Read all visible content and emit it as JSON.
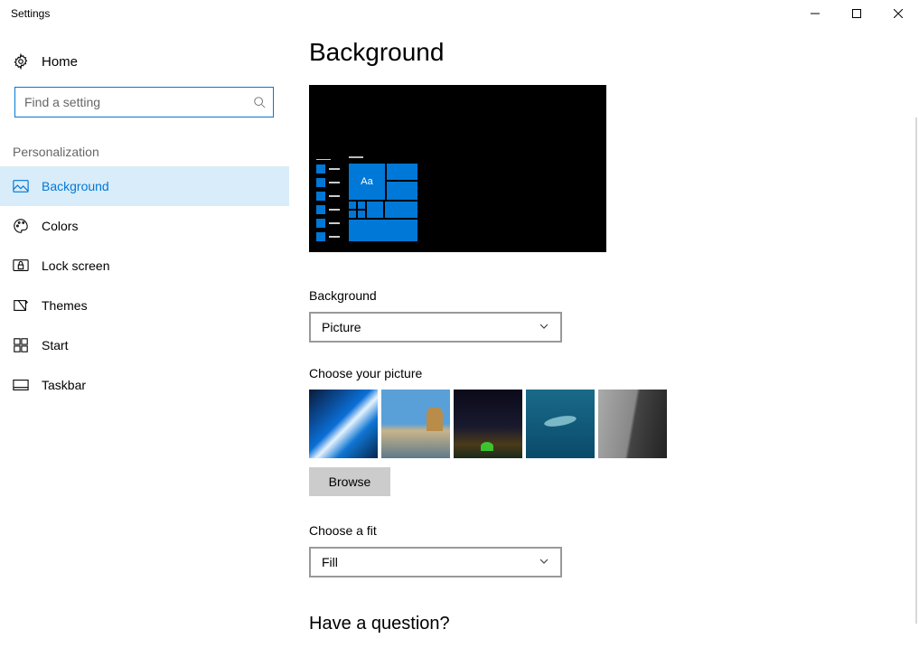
{
  "window": {
    "title": "Settings"
  },
  "sidebar": {
    "home": "Home",
    "search_placeholder": "Find a setting",
    "section": "Personalization",
    "items": [
      {
        "label": "Background",
        "icon": "picture-icon",
        "active": true
      },
      {
        "label": "Colors",
        "icon": "palette-icon"
      },
      {
        "label": "Lock screen",
        "icon": "lock-screen-icon"
      },
      {
        "label": "Themes",
        "icon": "themes-icon"
      },
      {
        "label": "Start",
        "icon": "start-icon"
      },
      {
        "label": "Taskbar",
        "icon": "taskbar-icon"
      }
    ]
  },
  "main": {
    "title": "Background",
    "preview_sample_text": "Aa",
    "background_label": "Background",
    "background_value": "Picture",
    "choose_picture_label": "Choose your picture",
    "browse_label": "Browse",
    "choose_fit_label": "Choose a fit",
    "choose_fit_value": "Fill",
    "question": "Have a question?"
  }
}
